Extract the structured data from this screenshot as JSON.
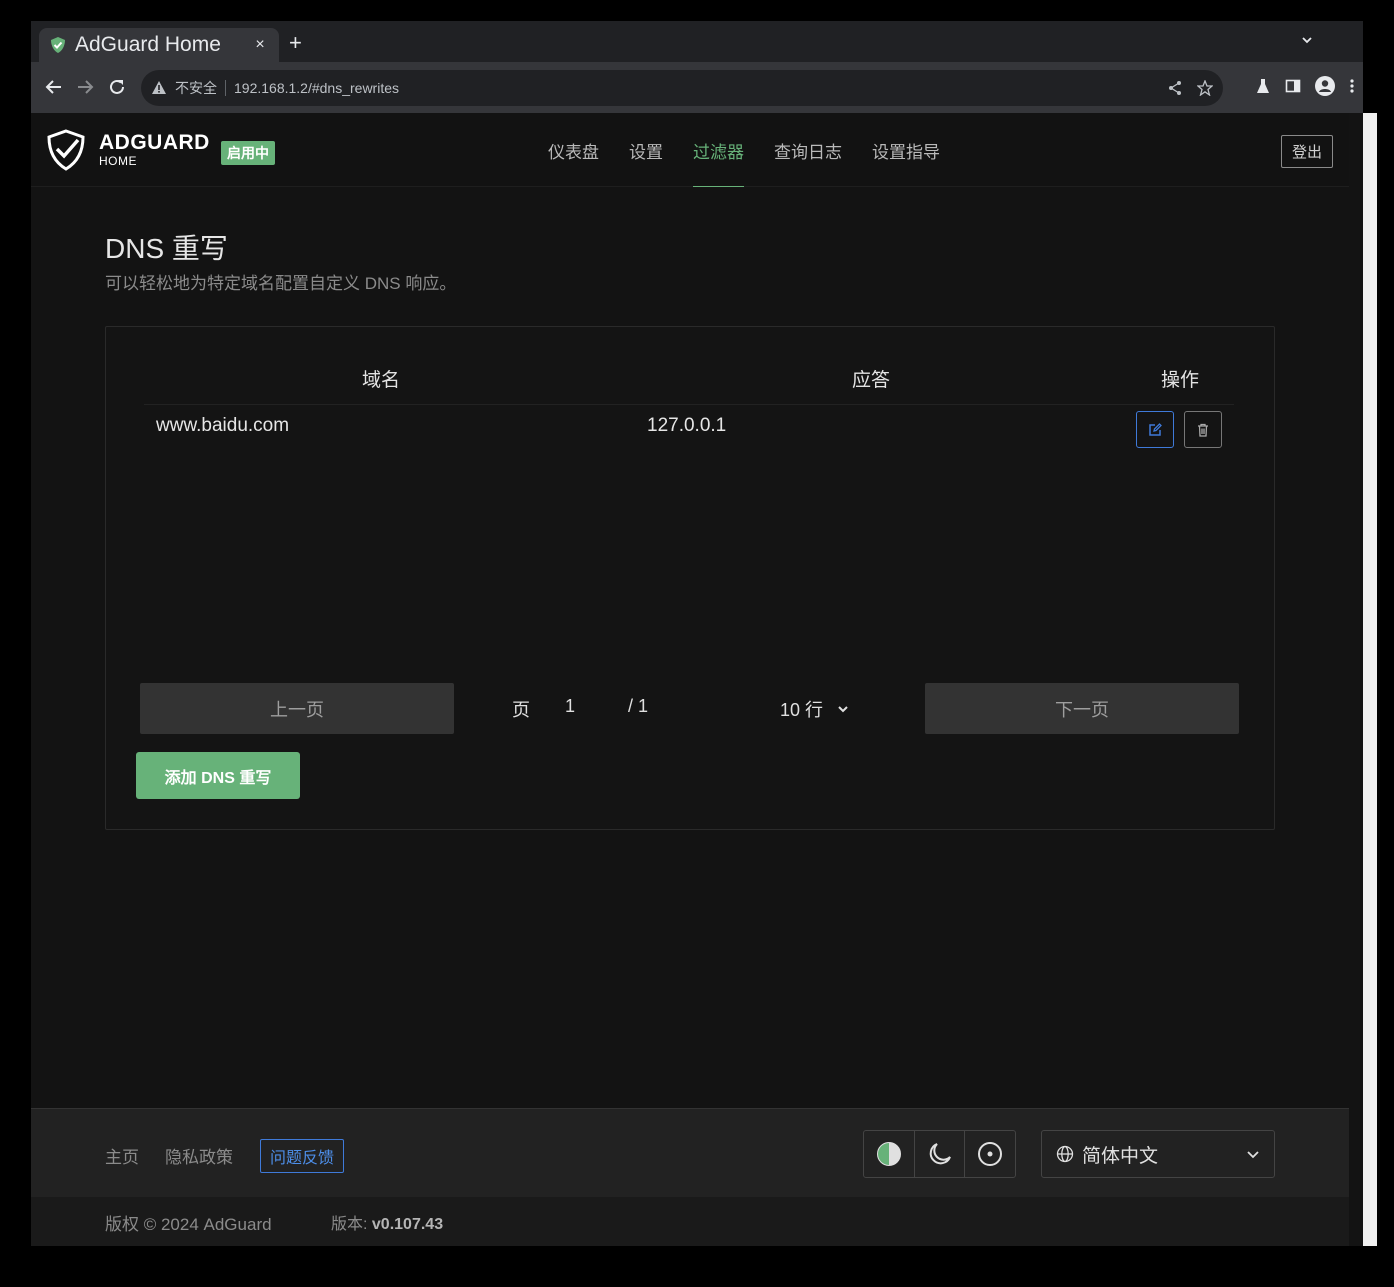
{
  "browser": {
    "tab_title": "AdGuard Home",
    "tab_close": "×",
    "new_tab": "+",
    "security_label": "不安全",
    "url": "192.168.1.2/#dns_rewrites"
  },
  "header": {
    "logo_title": "ADGUARD",
    "logo_sub": "HOME",
    "status": "启用中",
    "nav": [
      "仪表盘",
      "设置",
      "过滤器",
      "查询日志",
      "设置指导"
    ],
    "logout": "登出"
  },
  "page": {
    "title": "DNS 重写",
    "description": "可以轻松地为特定域名配置自定义 DNS 响应。"
  },
  "table": {
    "columns": [
      "域名",
      "应答",
      "操作"
    ],
    "rows": [
      {
        "domain": "www.baidu.com",
        "answer": "127.0.0.1"
      }
    ]
  },
  "pagination": {
    "prev": "上一页",
    "page_label": "页",
    "page": "1",
    "total": "/ 1",
    "rows": "10 行",
    "next": "下一页"
  },
  "add_button": "添加 DNS 重写",
  "footer": {
    "links": [
      "主页",
      "隐私政策"
    ],
    "feedback": "问题反馈",
    "language": "简体中文",
    "copyright": "版权 © 2024 AdGuard",
    "version_label": "版本: ",
    "version": "v0.107.43"
  },
  "colors": {
    "accent": "#67b279",
    "link_blue": "#3f7ad9",
    "background": "#131313"
  }
}
